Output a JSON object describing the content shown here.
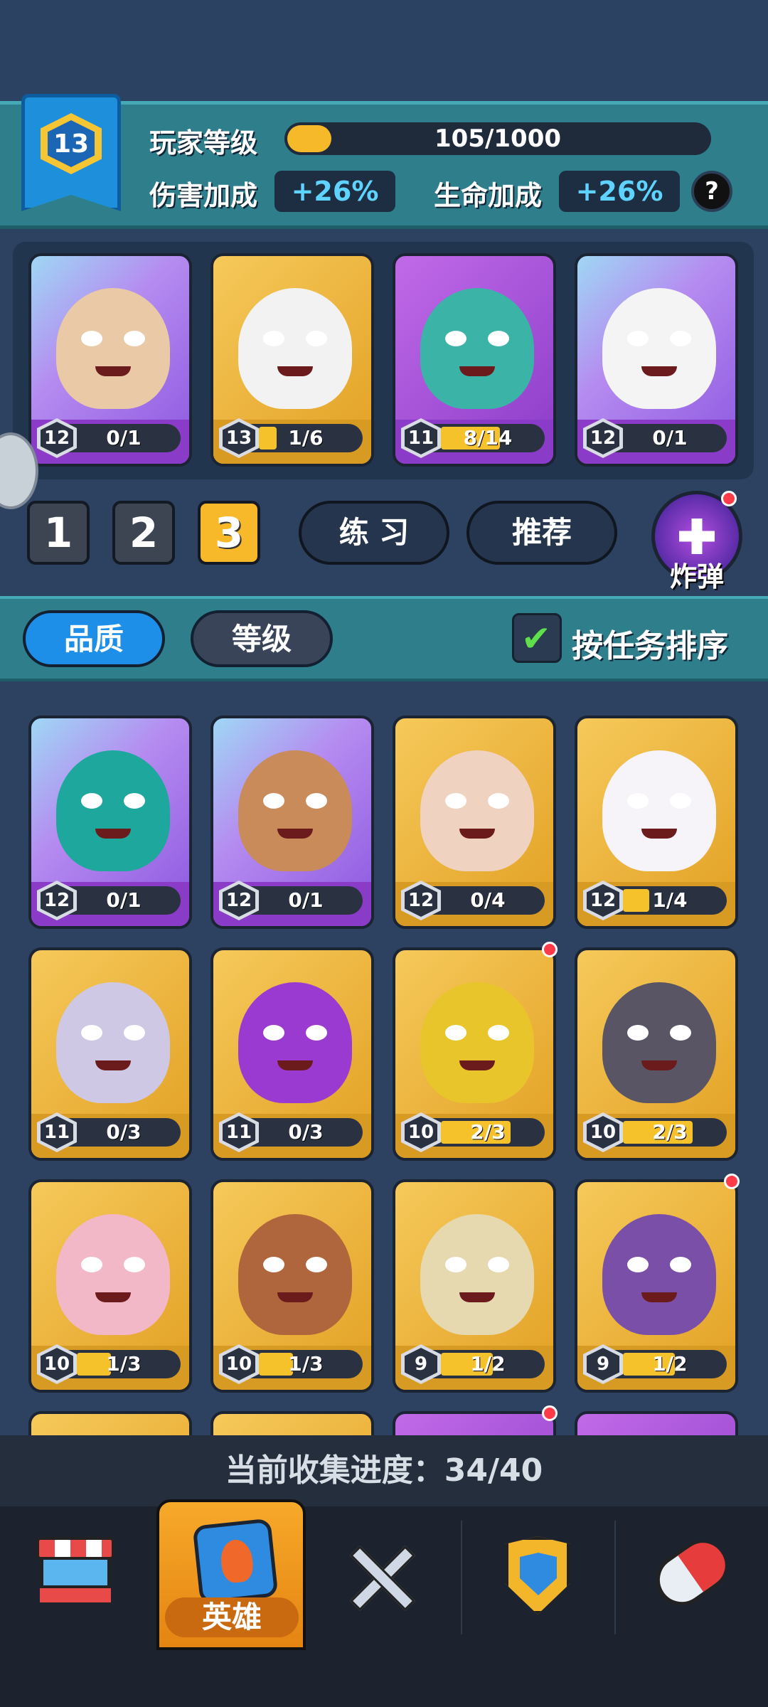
{
  "player": {
    "level": "13",
    "level_label": "玩家等级",
    "xp_text": "105/1000",
    "xp_fraction": 0.105,
    "damage_label": "伤害加成",
    "damage_value": "+26%",
    "hp_label": "生命加成",
    "hp_value": "+26%",
    "help": "?"
  },
  "team": [
    {
      "level": "12",
      "progress": "0/1",
      "fill": 0,
      "rarity": "purple"
    },
    {
      "level": "13",
      "progress": "1/6",
      "fill": 0.17,
      "rarity": "gold"
    },
    {
      "level": "11",
      "progress": "8/14",
      "fill": 0.57,
      "rarity": "purplecard"
    },
    {
      "level": "12",
      "progress": "0/1",
      "fill": 0,
      "rarity": "purple"
    }
  ],
  "decks": [
    "1",
    "2",
    "3"
  ],
  "selected_deck": "3",
  "practice_label": "练 习",
  "recommend_label": "推荐",
  "bomb_label": "炸弹",
  "filters": {
    "quality": "品质",
    "level": "等级",
    "sort_label": "按任务排序",
    "sort_checked": "✔"
  },
  "heroes": [
    {
      "level": "12",
      "progress": "0/1",
      "fill": 0,
      "rarity": "purple",
      "dot": false
    },
    {
      "level": "12",
      "progress": "0/1",
      "fill": 0,
      "rarity": "purple",
      "dot": false
    },
    {
      "level": "12",
      "progress": "0/4",
      "fill": 0,
      "rarity": "gold",
      "dot": false
    },
    {
      "level": "12",
      "progress": "1/4",
      "fill": 0.25,
      "rarity": "gold",
      "dot": false
    },
    {
      "level": "11",
      "progress": "0/3",
      "fill": 0,
      "rarity": "gold",
      "dot": false
    },
    {
      "level": "11",
      "progress": "0/3",
      "fill": 0,
      "rarity": "gold",
      "dot": false
    },
    {
      "level": "10",
      "progress": "2/3",
      "fill": 0.67,
      "rarity": "gold",
      "dot": true
    },
    {
      "level": "10",
      "progress": "2/3",
      "fill": 0.67,
      "rarity": "gold",
      "dot": false
    },
    {
      "level": "10",
      "progress": "1/3",
      "fill": 0.33,
      "rarity": "gold",
      "dot": false
    },
    {
      "level": "10",
      "progress": "1/3",
      "fill": 0.33,
      "rarity": "gold",
      "dot": false
    },
    {
      "level": "9",
      "progress": "1/2",
      "fill": 0.5,
      "rarity": "gold",
      "dot": false
    },
    {
      "level": "9",
      "progress": "1/2",
      "fill": 0.5,
      "rarity": "gold",
      "dot": true
    },
    {
      "level": "",
      "progress": "",
      "fill": 0,
      "rarity": "gold",
      "dot": false
    },
    {
      "level": "",
      "progress": "",
      "fill": 0,
      "rarity": "gold",
      "dot": false
    },
    {
      "level": "",
      "progress": "",
      "fill": 0,
      "rarity": "purplecard",
      "dot": true
    },
    {
      "level": "",
      "progress": "",
      "fill": 0,
      "rarity": "purplecard",
      "dot": false
    }
  ],
  "collection_progress": "当前收集进度：34/40",
  "nav": {
    "heroes_label": "英雄",
    "items": [
      "shop-icon",
      "heroes-card-icon",
      "battle-swords-icon",
      "clan-shield-icon",
      "gacha-capsule-icon"
    ]
  },
  "colors": {
    "hero_tint": [
      "#e9c9a6",
      "#f2f2f2",
      "#3bb3a6",
      "#f4f4f4",
      "#1ea79c",
      "#c98b5a",
      "#f0d2c0",
      "#f6f4f8",
      "#cfc8e4",
      "#9b3ad0",
      "#e8c52a",
      "#5a5565",
      "#f2b8c8",
      "#b0663c",
      "#e6d9b0",
      "#7a4fa8"
    ]
  }
}
